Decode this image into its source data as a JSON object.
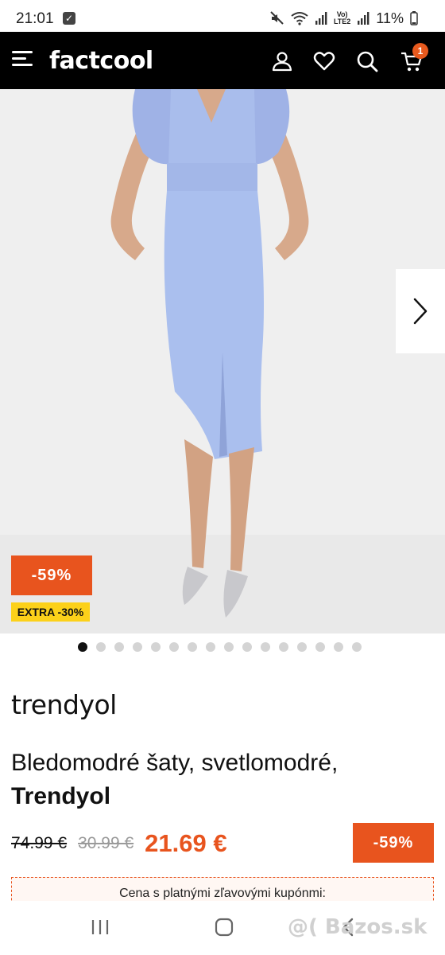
{
  "status_bar": {
    "time": "21:01",
    "lte": "Vo)\nLTE2",
    "battery": "11%"
  },
  "header": {
    "logo": "factcool",
    "cart_count": "1",
    "icons": [
      "menu-icon",
      "account-icon",
      "heart-icon",
      "search-icon",
      "cart-icon"
    ]
  },
  "gallery": {
    "discount_badge": "-59%",
    "extra_badge": "EXTRA -30%",
    "dot_count": 16,
    "active_dot": 0
  },
  "product": {
    "brand": "trendyol",
    "title": "Bledomodré šaty, svetlomodré,",
    "title_brand": "Trendyol"
  },
  "prices": {
    "original": "74.99 €",
    "previous": "30.99 €",
    "current": "21.69 €",
    "discount": "-59%"
  },
  "coupon": {
    "text": "Cena s platnými zľavovými kupónmi:"
  },
  "watermark": "@( Bazos.sk",
  "colors": {
    "accent": "#e8541e",
    "extra_badge": "#fcd11a",
    "header_bg": "#000000",
    "dress": "#a9bdec"
  }
}
